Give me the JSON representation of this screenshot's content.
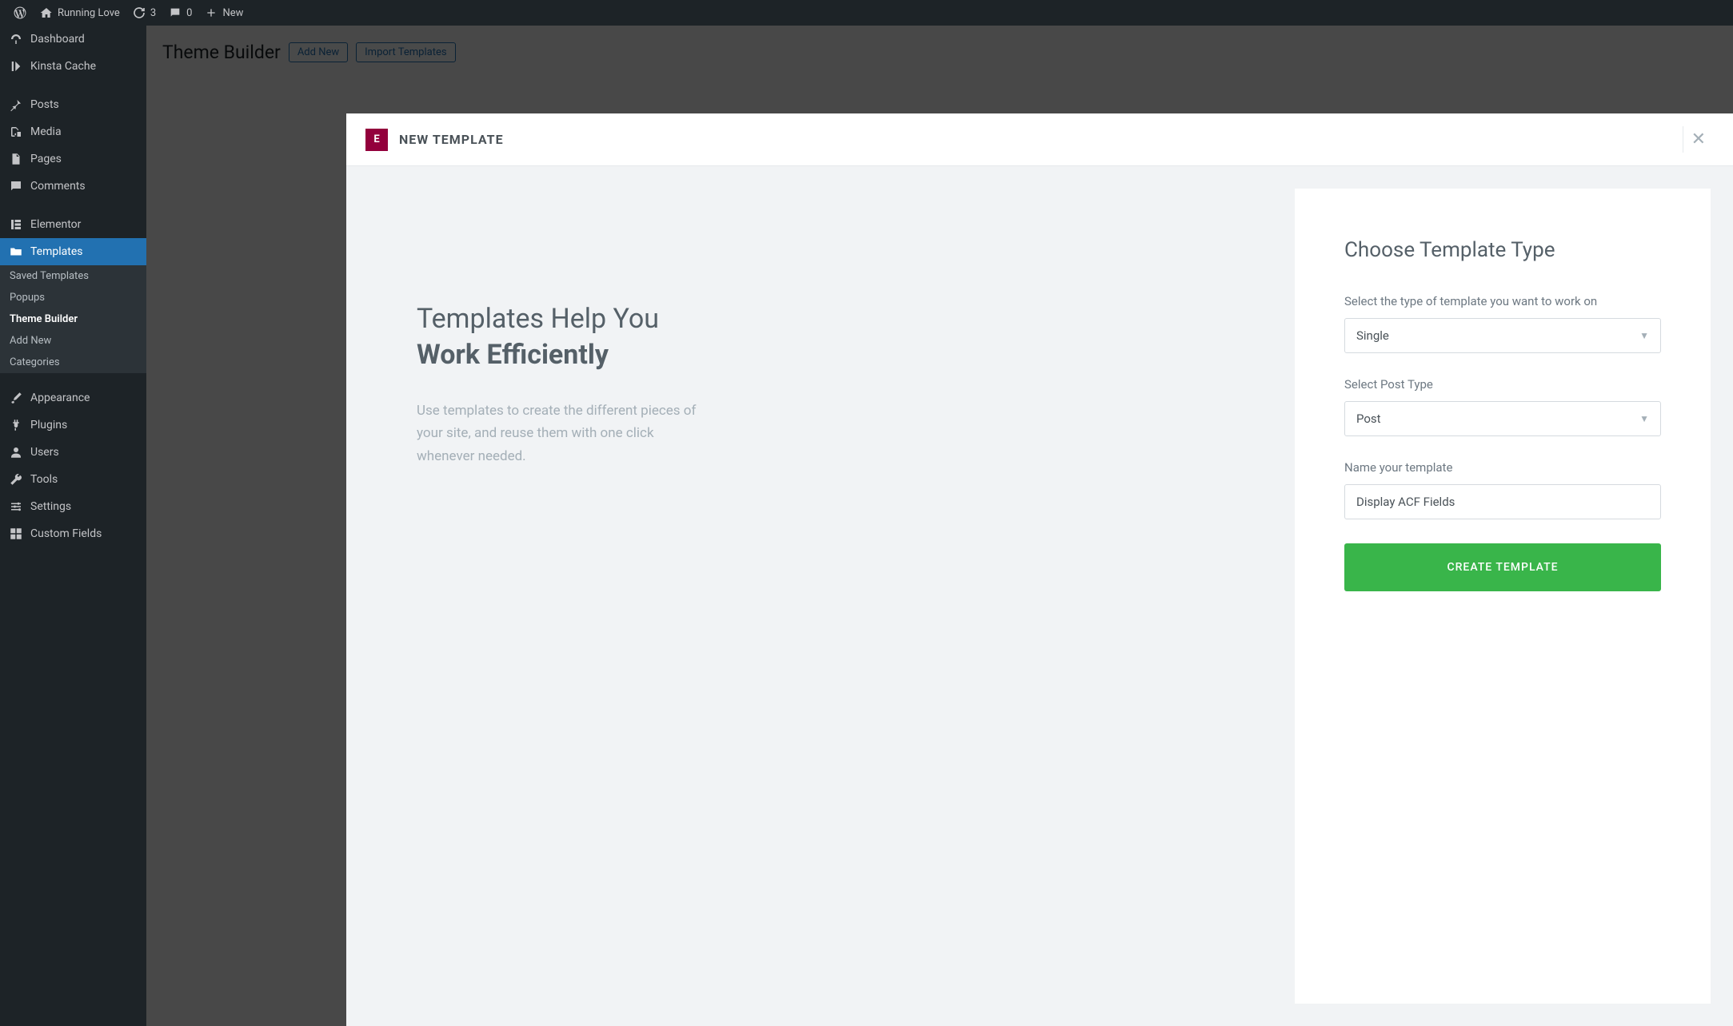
{
  "adminbar": {
    "site_name": "Running Love",
    "updates": "3",
    "comments": "0",
    "new_label": "New"
  },
  "sidebar": {
    "dashboard": "Dashboard",
    "kinsta": "Kinsta Cache",
    "posts": "Posts",
    "media": "Media",
    "pages": "Pages",
    "comments": "Comments",
    "elementor": "Elementor",
    "templates": "Templates",
    "sub_saved": "Saved Templates",
    "sub_popups": "Popups",
    "sub_theme": "Theme Builder",
    "sub_addnew": "Add New",
    "sub_categories": "Categories",
    "appearance": "Appearance",
    "plugins": "Plugins",
    "users": "Users",
    "tools": "Tools",
    "settings": "Settings",
    "custom_fields": "Custom Fields"
  },
  "page": {
    "title": "Theme Builder",
    "add_new": "Add New",
    "import": "Import Templates"
  },
  "modal": {
    "title": "NEW TEMPLATE",
    "help_line1": "Templates Help You",
    "help_line2": "Work Efficiently",
    "help_desc": "Use templates to create the different pieces of your site, and reuse them with one click whenever needed.",
    "form_heading": "Choose Template Type",
    "type_label": "Select the type of template you want to work on",
    "type_value": "Single",
    "posttype_label": "Select Post Type",
    "posttype_value": "Post",
    "name_label": "Name your template",
    "name_value": "Display ACF Fields",
    "create_btn": "CREATE TEMPLATE"
  }
}
